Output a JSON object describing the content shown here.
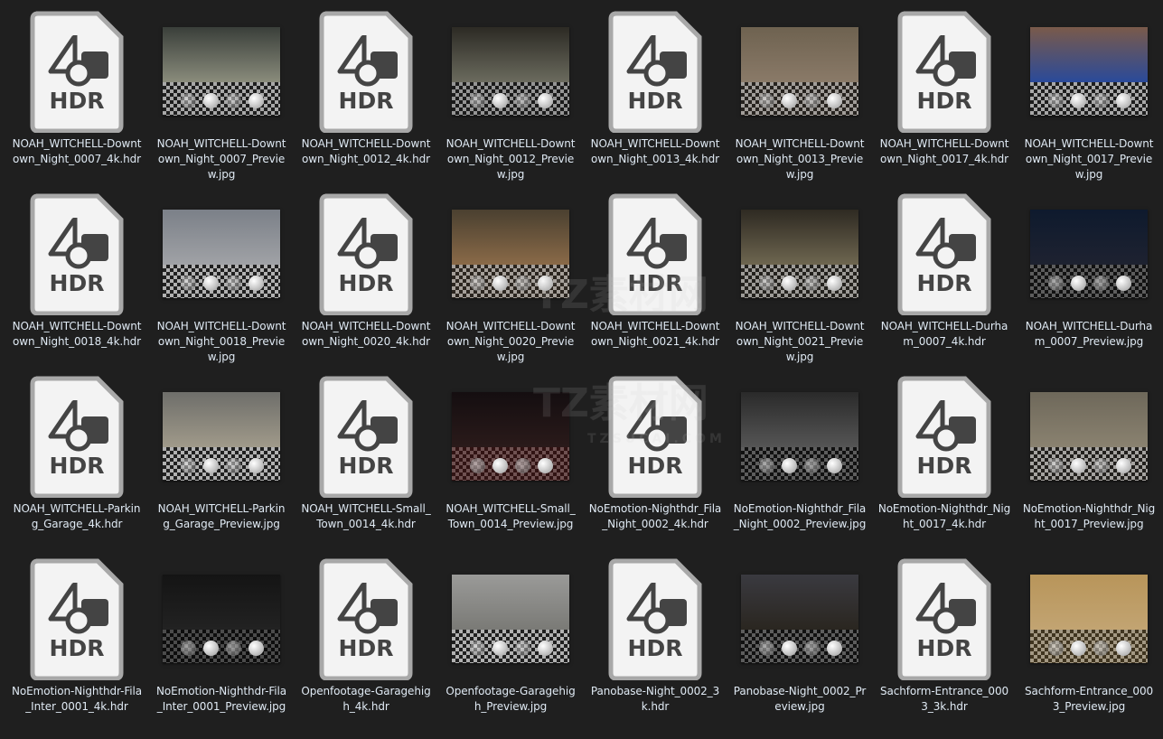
{
  "hdr_icon_label": "HDR",
  "items": [
    {
      "type": "hdr",
      "name": "NOAH_WITCHELL-Downtown_Night_0007_4k.hdr"
    },
    {
      "type": "jpg",
      "name": "NOAH_WITCHELL-Downtown_Night_0007_Preview.jpg",
      "sky": "#3a3f3a",
      "ground": "#8a8c7c",
      "tint": "rgba(0,0,0,0.1)"
    },
    {
      "type": "hdr",
      "name": "NOAH_WITCHELL-Downtown_Night_0012_4k.hdr"
    },
    {
      "type": "jpg",
      "name": "NOAH_WITCHELL-Downtown_Night_0012_Preview.jpg",
      "sky": "#2c2a24",
      "ground": "#6b6b5e",
      "tint": "rgba(0,0,0,0.2)"
    },
    {
      "type": "hdr",
      "name": "NOAH_WITCHELL-Downtown_Night_0013_4k.hdr"
    },
    {
      "type": "jpg",
      "name": "NOAH_WITCHELL-Downtown_Night_0013_Preview.jpg",
      "sky": "#6e6250",
      "ground": "#8a7a68",
      "tint": "rgba(60,40,20,0.2)"
    },
    {
      "type": "hdr",
      "name": "NOAH_WITCHELL-Downtown_Night_0017_4k.hdr"
    },
    {
      "type": "jpg",
      "name": "NOAH_WITCHELL-Downtown_Night_0017_Preview.jpg",
      "sky": "#7a5a4a",
      "ground": "#2a4a9a",
      "tint": "rgba(0,0,0,0.1)"
    },
    {
      "type": "hdr",
      "name": "NOAH_WITCHELL-Downtown_Night_0018_4k.hdr"
    },
    {
      "type": "jpg",
      "name": "NOAH_WITCHELL-Downtown_Night_0018_Preview.jpg",
      "sky": "#7b8088",
      "ground": "#a0a2a6",
      "tint": "rgba(0,0,0,0.05)"
    },
    {
      "type": "hdr",
      "name": "NOAH_WITCHELL-Downtown_Night_0020_4k.hdr"
    },
    {
      "type": "jpg",
      "name": "NOAH_WITCHELL-Downtown_Night_0020_Preview.jpg",
      "sky": "#4a4030",
      "ground": "#8a6a48",
      "tint": "rgba(80,50,20,0.2)"
    },
    {
      "type": "hdr",
      "name": "NOAH_WITCHELL-Downtown_Night_0021_4k.hdr"
    },
    {
      "type": "jpg",
      "name": "NOAH_WITCHELL-Downtown_Night_0021_Preview.jpg",
      "sky": "#2e2a22",
      "ground": "#6e6650",
      "tint": "rgba(40,30,10,0.2)"
    },
    {
      "type": "hdr",
      "name": "NOAH_WITCHELL-Durham_0007_4k.hdr"
    },
    {
      "type": "jpg",
      "name": "NOAH_WITCHELL-Durham_0007_Preview.jpg",
      "sky": "#0e1a2e",
      "ground": "#1e2230",
      "tint": "rgba(0,0,0,0.5)"
    },
    {
      "type": "hdr",
      "name": "NOAH_WITCHELL-Parking_Garage_4k.hdr"
    },
    {
      "type": "jpg",
      "name": "NOAH_WITCHELL-Parking_Garage_Preview.jpg",
      "sky": "#6e6e6a",
      "ground": "#a09a8a",
      "tint": "rgba(0,0,0,0.05)"
    },
    {
      "type": "hdr",
      "name": "NOAH_WITCHELL-Small_Town_0014_4k.hdr"
    },
    {
      "type": "jpg",
      "name": "NOAH_WITCHELL-Small_Town_0014_Preview.jpg",
      "sky": "#140e10",
      "ground": "#2a1a1a",
      "tint": "rgba(60,10,10,0.6)"
    },
    {
      "type": "hdr",
      "name": "NoEmotion-Nighthdr_Fila_Night_0002_4k.hdr"
    },
    {
      "type": "jpg",
      "name": "NoEmotion-Nighthdr_Fila_Night_0002_Preview.jpg",
      "sky": "#2a2a2a",
      "ground": "#555555",
      "tint": "rgba(0,0,0,0.5)"
    },
    {
      "type": "hdr",
      "name": "NoEmotion-Nighthdr_Night_0017_4k.hdr"
    },
    {
      "type": "jpg",
      "name": "NoEmotion-Nighthdr_Night_0017_Preview.jpg",
      "sky": "#6e685a",
      "ground": "#8a8270",
      "tint": "rgba(40,30,10,0.15)"
    },
    {
      "type": "hdr",
      "name": "NoEmotion-Nighthdr-Fila_Inter_0001_4k.hdr"
    },
    {
      "type": "jpg",
      "name": "NoEmotion-Nighthdr-Fila_Inter_0001_Preview.jpg",
      "sky": "#141414",
      "ground": "#222222",
      "tint": "rgba(0,0,0,0.6)"
    },
    {
      "type": "hdr",
      "name": "Openfootage-Garagehigh_4k.hdr"
    },
    {
      "type": "jpg",
      "name": "Openfootage-Garagehigh_Preview.jpg",
      "sky": "#9a9a98",
      "ground": "#7a7a76",
      "tint": "rgba(0,0,0,0.05)"
    },
    {
      "type": "hdr",
      "name": "Panobase-Night_0002_3k.hdr"
    },
    {
      "type": "jpg",
      "name": "Panobase-Night_0002_Preview.jpg",
      "sky": "#3a3a40",
      "ground": "#2a2620",
      "tint": "rgba(0,0,0,0.5)"
    },
    {
      "type": "hdr",
      "name": "Sachform-Entrance_0003_3k.hdr"
    },
    {
      "type": "jpg",
      "name": "Sachform-Entrance_0003_Preview.jpg",
      "sky": "#b8955a",
      "ground": "#c2a472",
      "tint": "rgba(120,90,30,0.35)"
    }
  ],
  "watermark": {
    "text": "TZ素材网",
    "sub": "TZSUCAI.COM"
  }
}
